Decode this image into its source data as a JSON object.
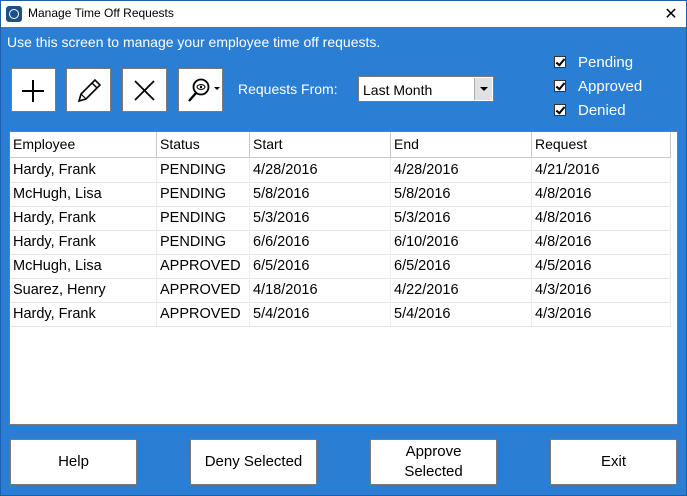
{
  "window": {
    "title": "Manage Time Off Requests",
    "close_glyph": "✕"
  },
  "instructions": "Use this screen to manage your employee time off requests.",
  "toolbar": {
    "icons": [
      "plus-icon",
      "pencil-icon",
      "x-icon",
      "find-dropdown-icon"
    ],
    "requests_from_label": "Requests From:",
    "requests_from_value": "Last Month"
  },
  "filters": [
    {
      "label": "Pending",
      "checked": true
    },
    {
      "label": "Approved",
      "checked": true
    },
    {
      "label": "Denied",
      "checked": true
    }
  ],
  "table": {
    "columns": [
      "Employee",
      "Status",
      "Start",
      "End",
      "Request"
    ],
    "rows": [
      [
        "Hardy, Frank",
        "PENDING",
        "4/28/2016",
        "4/28/2016",
        "4/21/2016"
      ],
      [
        "McHugh, Lisa",
        "PENDING",
        "5/8/2016",
        "5/8/2016",
        "4/8/2016"
      ],
      [
        "Hardy, Frank",
        "PENDING",
        "5/3/2016",
        "5/3/2016",
        "4/8/2016"
      ],
      [
        "Hardy, Frank",
        "PENDING",
        "6/6/2016",
        "6/10/2016",
        "4/8/2016"
      ],
      [
        "McHugh, Lisa",
        "APPROVED",
        "6/5/2016",
        "6/5/2016",
        "4/5/2016"
      ],
      [
        "Suarez, Henry",
        "APPROVED",
        "4/18/2016",
        "4/22/2016",
        "4/3/2016"
      ],
      [
        "Hardy, Frank",
        "APPROVED",
        "5/4/2016",
        "5/4/2016",
        "4/3/2016"
      ]
    ]
  },
  "buttons": {
    "help": "Help",
    "deny": "Deny Selected",
    "approve_line1": "Approve",
    "approve_line2": "Selected",
    "exit": "Exit"
  },
  "colors": {
    "background": "#2a7fd4",
    "text_on_bg": "#ffffff"
  }
}
